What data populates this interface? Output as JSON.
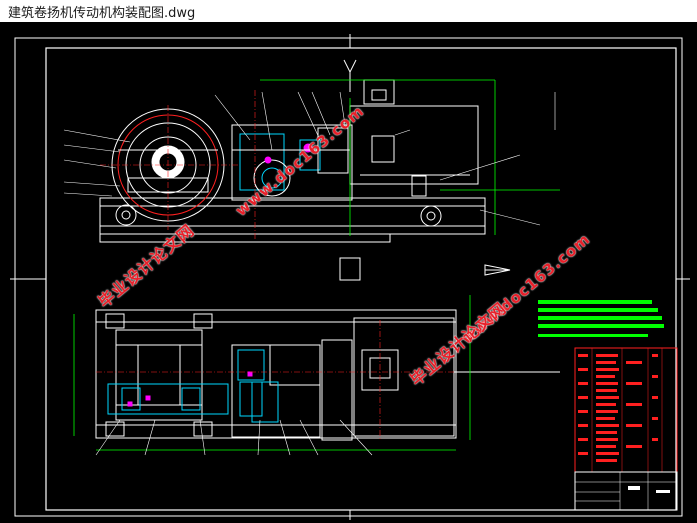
{
  "window": {
    "title": "建筑卷扬机传动机构装配图.dwg"
  },
  "watermarks": {
    "brand": "毕业设计论文网",
    "site": "www.doc163.com"
  },
  "colors": {
    "background": "#000000",
    "frame": "#ffffff",
    "outline": "#ffffff",
    "section": "#00d8ff",
    "accent": "#ff00ff",
    "dimension": "#00ff00",
    "parts_table": "#ff0000",
    "centerline": "#ff0000",
    "notes": "#00ff00"
  }
}
